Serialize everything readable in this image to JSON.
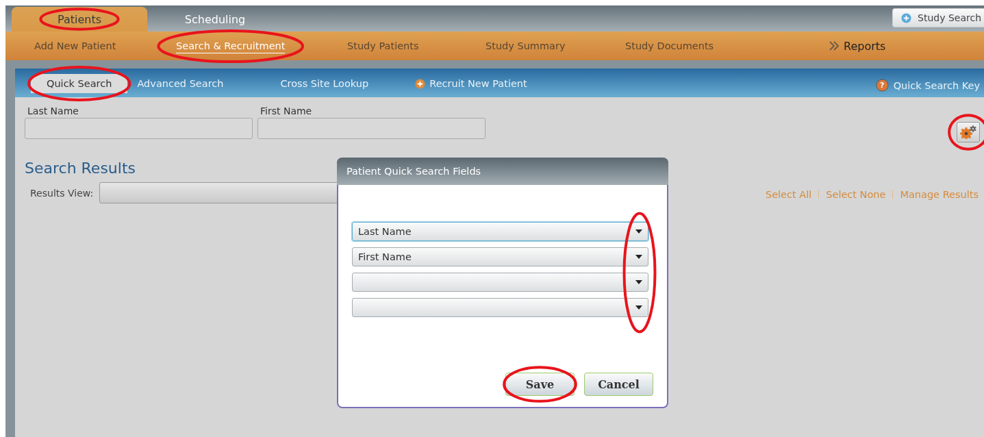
{
  "top_tabs": [
    {
      "label": "Patients",
      "selected": true,
      "circled": true
    },
    {
      "label": "Scheduling",
      "selected": false,
      "circled": false
    }
  ],
  "study_search_button": {
    "label": "Study Search"
  },
  "nav": [
    {
      "label": "Add New Patient",
      "selected": false,
      "circled": false,
      "kind": "link"
    },
    {
      "label": "Search & Recruitment",
      "selected": true,
      "circled": true,
      "kind": "link"
    },
    {
      "label": "Study Patients",
      "selected": false,
      "circled": false,
      "kind": "link"
    },
    {
      "label": "Study Summary",
      "selected": false,
      "circled": false,
      "kind": "link"
    },
    {
      "label": "Study Documents",
      "selected": false,
      "circled": false,
      "kind": "link"
    },
    {
      "label": "Reports",
      "selected": false,
      "circled": false,
      "kind": "chevron"
    }
  ],
  "sub_tabs": [
    {
      "label": "Quick Search",
      "selected": true,
      "circled": true,
      "kind": "tab"
    },
    {
      "label": "Advanced Search",
      "selected": false,
      "circled": false,
      "kind": "tab"
    },
    {
      "label": "Cross Site Lookup",
      "selected": false,
      "circled": false,
      "kind": "tab"
    },
    {
      "label": "Recruit New Patient",
      "selected": false,
      "circled": false,
      "kind": "add"
    }
  ],
  "quick_search_key": {
    "icon": "?",
    "label": "Quick Search Key"
  },
  "fields": [
    {
      "label": "Last Name"
    },
    {
      "label": "First Name"
    }
  ],
  "settings_button": {
    "circled": true
  },
  "results": {
    "title": "Search Results",
    "view_label": "Results View:",
    "links": [
      "Select All",
      "Select None",
      "Manage Results"
    ]
  },
  "dialog": {
    "title": "Patient Quick Search Fields",
    "arrows_circled": true,
    "selects": [
      {
        "value": "Last Name",
        "focused": true
      },
      {
        "value": "First Name",
        "focused": false
      },
      {
        "focused": false
      },
      {
        "focused": false
      }
    ],
    "buttons": [
      {
        "label": "Save",
        "circled": true
      },
      {
        "label": "Cancel",
        "circled": false
      }
    ]
  }
}
